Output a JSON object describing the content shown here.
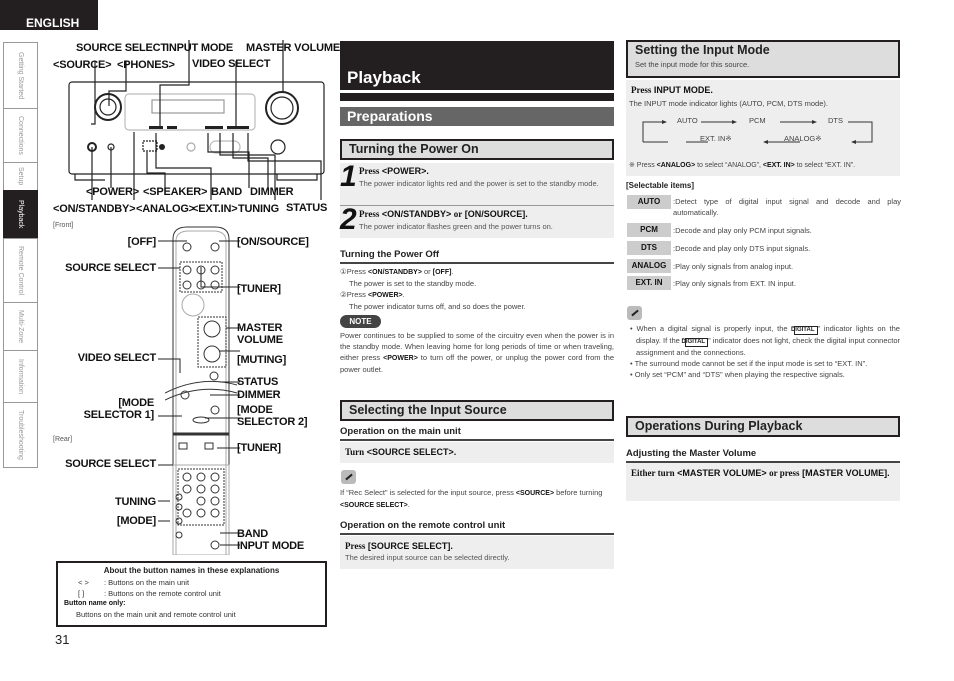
{
  "language_tab": "ENGLISH",
  "side_nav": [
    {
      "label": "Getting Started",
      "active": false
    },
    {
      "label": "Connections",
      "active": false
    },
    {
      "label": "Setup",
      "active": false
    },
    {
      "label": "Playback",
      "active": true
    },
    {
      "label": "Remote Control",
      "active": false
    },
    {
      "label": "Multi-Zone",
      "active": false
    },
    {
      "label": "Information",
      "active": false
    },
    {
      "label": "Troubleshooting",
      "active": false
    }
  ],
  "front_panel": {
    "callouts_top": [
      "SOURCE SELECT",
      "INPUT MODE",
      "MASTER VOLUME",
      "<SOURCE>",
      "<PHONES>",
      "VIDEO SELECT"
    ],
    "callouts_bottom": [
      "<POWER>",
      "<SPEAKER>",
      "BAND",
      "DIMMER",
      "<ON/STANDBY>",
      "<ANALOG>",
      "<EXT.IN>",
      "TUNING",
      "STATUS"
    ]
  },
  "remote_front": {
    "caption": "[Front]",
    "left": [
      "[OFF]",
      "SOURCE SELECT",
      "VIDEO SELECT",
      "[MODE",
      "SELECTOR 1]"
    ],
    "right": [
      "[ON/SOURCE]",
      "[TUNER]",
      "MASTER",
      "VOLUME",
      "[MUTING]",
      "STATUS",
      "DIMMER",
      "[MODE",
      "SELECTOR 2]"
    ]
  },
  "remote_rear": {
    "caption": "[Rear]",
    "left": [
      "SOURCE SELECT",
      "TUNING",
      "[MODE]"
    ],
    "right": [
      "[TUNER]",
      "BAND",
      "INPUT MODE"
    ]
  },
  "legend": {
    "title": "About the button names in these explanations",
    "rows": [
      {
        "sym": "<    >",
        "text": ": Buttons on the main unit"
      },
      {
        "sym": "[     ]",
        "text": ": Buttons on the remote control unit"
      }
    ],
    "bn_label": "Button name only:",
    "bn_text": "Buttons on the main unit and remote control unit"
  },
  "page_number": "31",
  "middle": {
    "title": "Playback",
    "section": "Preparations",
    "power_on": {
      "heading": "Turning the Power On",
      "steps": [
        {
          "num": "1",
          "press": "Press",
          "key": "<POWER>.",
          "desc": "The power indicator lights red and the power is set to the standby mode."
        },
        {
          "num": "2",
          "press": "Press",
          "key": "<ON/STANDBY>",
          "or": "or",
          "key2": "[ON/SOURCE].",
          "desc": "The power indicator flashes green and the power turns on."
        }
      ]
    },
    "power_off": {
      "heading": "Turning the Power Off",
      "line1_prefix": "①Press ",
      "line1_key1": "<ON/STANDBY>",
      "line1_mid": " or ",
      "line1_key2": "[OFF]",
      "line1_end": ".",
      "line1_desc": "The power is set to the standby mode.",
      "line2_prefix": "②Press ",
      "line2_key": "<POWER>",
      "line2_end": ".",
      "line2_desc": "The power indicator turns off, and so does the power."
    },
    "note": {
      "label": "NOTE",
      "text_a": "Power continues to be supplied to some of the circuitry even when the power is in the standby mode. When leaving home for long periods of time or when traveling, either press ",
      "key": "<POWER>",
      "text_b": " to turn off the power, or unplug the power cord from the power outlet."
    },
    "input_source": {
      "heading": "Selecting the Input Source",
      "main_unit_heading": "Operation on the main unit",
      "main_unit_turn": "Turn",
      "main_unit_key": "<SOURCE SELECT>.",
      "tip_a": "If “Rec Select” is selected for the input source, press ",
      "tip_key1": "<SOURCE>",
      "tip_b": " before turning ",
      "tip_key2": "<SOURCE SELECT>",
      "tip_c": ".",
      "remote_heading": "Operation on the remote control unit",
      "remote_press": "Press",
      "remote_key": "[SOURCE SELECT].",
      "remote_desc": "The desired input source can be selected directly."
    }
  },
  "right": {
    "input_mode": {
      "heading": "Setting the Input Mode",
      "subheading": "Set the input mode for this source.",
      "press": "Press",
      "key": "INPUT MODE.",
      "desc": "The INPUT mode indicator lights (AUTO, PCM, DTS mode).",
      "flow_top": [
        "AUTO",
        "PCM",
        "DTS"
      ],
      "flow_bottom": [
        "EXT. IN※",
        "ANALOG※"
      ],
      "footnote_a": "※ Press ",
      "footnote_key1": "<ANALOG>",
      "footnote_b": " to select “ANALOG”, ",
      "footnote_key2": "<EXT. IN>",
      "footnote_c": " to select “EXT. IN”."
    },
    "selectable": {
      "heading": "[Selectable items]",
      "items": [
        {
          "tag": "AUTO",
          "desc": ":Detect type of digital input signal and decode and play automatically."
        },
        {
          "tag": "PCM",
          "desc": ":Decode and play only PCM input signals."
        },
        {
          "tag": "DTS",
          "desc": ":Decode and play only DTS input signals."
        },
        {
          "tag": "ANALOG",
          "desc": ":Play only signals from analog input."
        },
        {
          "tag": "EXT. IN",
          "desc": ":Play only signals from EXT. IN input."
        }
      ]
    },
    "tips": {
      "digital_badge": "DIGITAL",
      "b1_a": "When a digital signal is properly input, the “",
      "b1_b": "” indicator lights on the display. If the “",
      "b1_c": "” indicator does not light, check the digital input connector assignment and the connections.",
      "b2": "The surround mode cannot be set if the input mode is set to “EXT. IN”.",
      "b3": "Only set “PCM” and “DTS” when playing the respective signals."
    },
    "operations": {
      "heading": "Operations During Playback",
      "sub": "Adjusting the Master Volume",
      "either": "Either turn",
      "key1": "<MASTER VOLUME>",
      "or": "or press",
      "key2": "[MASTER VOLUME]."
    }
  }
}
